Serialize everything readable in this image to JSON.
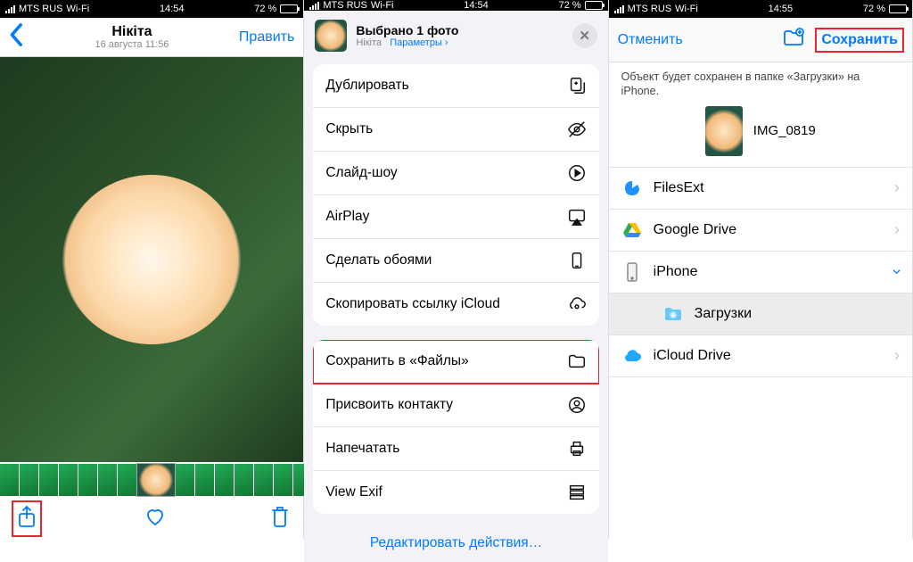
{
  "status": {
    "carrier": "MTS RUS",
    "wifi": "Wi-Fi",
    "battery_pct": "72 %",
    "time_1": "14:54",
    "time_2": "14:54",
    "time_3": "14:55"
  },
  "p1": {
    "title": "Нікіта",
    "subtitle": "16 августа 11:56",
    "edit": "Править"
  },
  "p2": {
    "header_title": "Выбрано 1 фото",
    "header_sub_owner": "Нікіта",
    "header_sub_params": "Параметры ›",
    "actions_group1": [
      "Дублировать",
      "Скрыть",
      "Слайд-шоу",
      "AirPlay",
      "Сделать обоями",
      "Скопировать ссылку iCloud"
    ],
    "actions_group2": [
      "Сохранить в «Файлы»",
      "Присвоить контакту",
      "Напечатать",
      "View Exif"
    ],
    "edit_actions": "Редактировать действия…"
  },
  "p3": {
    "cancel": "Отменить",
    "save": "Сохранить",
    "msg": "Объект будет сохранен в папке «Загрузки» на iPhone.",
    "fname": "IMG_0819",
    "locations": [
      {
        "name": "FilesExt",
        "icon": "filesext"
      },
      {
        "name": "Google Drive",
        "icon": "gdrive"
      },
      {
        "name": "iPhone",
        "icon": "iphone"
      },
      {
        "name": "Загрузки",
        "icon": "downloads",
        "sub": true
      },
      {
        "name": "iCloud Drive",
        "icon": "icloud"
      }
    ]
  }
}
